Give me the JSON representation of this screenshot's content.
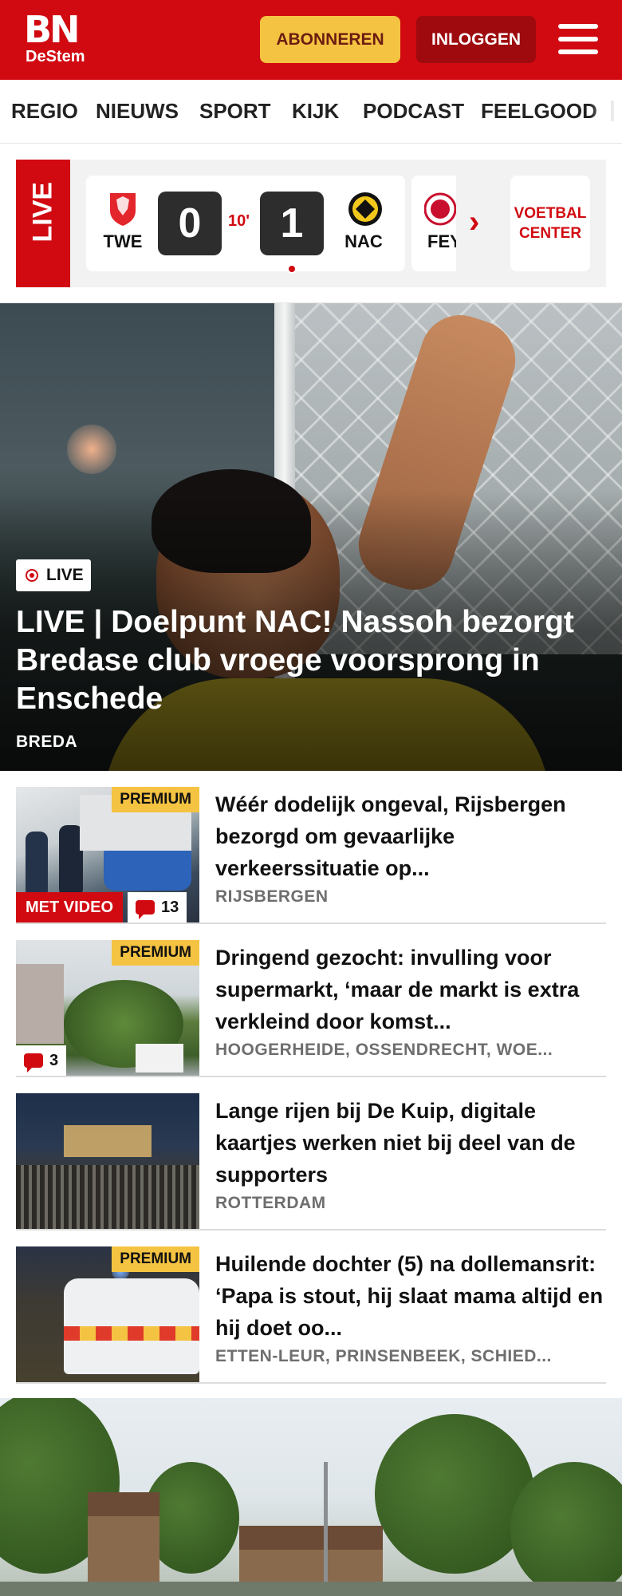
{
  "header": {
    "logo_main": "BN",
    "logo_sub": "DeStem",
    "subscribe_label": "ABONNEREN",
    "login_label": "INLOGGEN",
    "brand_color": "#d10a11",
    "subscribe_color": "#f5c342"
  },
  "nav": {
    "items": [
      {
        "label": "REGIO"
      },
      {
        "label": "NIEUWS"
      },
      {
        "label": "SPORT"
      },
      {
        "label": "KIJK"
      },
      {
        "label": "PODCAST"
      },
      {
        "label": "FEELGOOD"
      }
    ]
  },
  "live_scores": {
    "live_label": "LIVE",
    "match": {
      "home_team": "TWE",
      "away_team": "NAC",
      "home_score": "0",
      "away_score": "1",
      "minute": "10'"
    },
    "next_team": "FEY",
    "voetbal_center_label": "VOETBAL CENTER"
  },
  "hero": {
    "badge": "LIVE",
    "title": "LIVE | Doelpunt NAC! Nassoh bezorgt Bredase club vroege voorsprong in Enschede",
    "location": "BREDA"
  },
  "articles": [
    {
      "premium": "PREMIUM",
      "video": "MET VIDEO",
      "comments": "13",
      "title": "Wéér dodelijk ongeval, Rijsbergen bezorgd om gevaarlij­ke verkeerssituatie op...",
      "location": "RIJSBERGEN"
    },
    {
      "premium": "PREMIUM",
      "comments": "3",
      "title": "Dringend gezocht: invulling voor supermarkt, ‘maar de markt is extra verkleind door komst...",
      "location": "HOOGERHEIDE, OSSENDRECHT, WOE..."
    },
    {
      "title": "Lange rijen bij De Kuip, digitale kaartjes werken niet bij deel van de supporters",
      "location": "ROTTERDAM"
    },
    {
      "premium": "PREMIUM",
      "title": "Huilende dochter (5) na dollemansrit: ‘Papa is stout, hij slaat mama altijd en hij doet oo...",
      "location": "ETTEN-LEUR, PRINSENBEEK, SCHIED..."
    }
  ]
}
